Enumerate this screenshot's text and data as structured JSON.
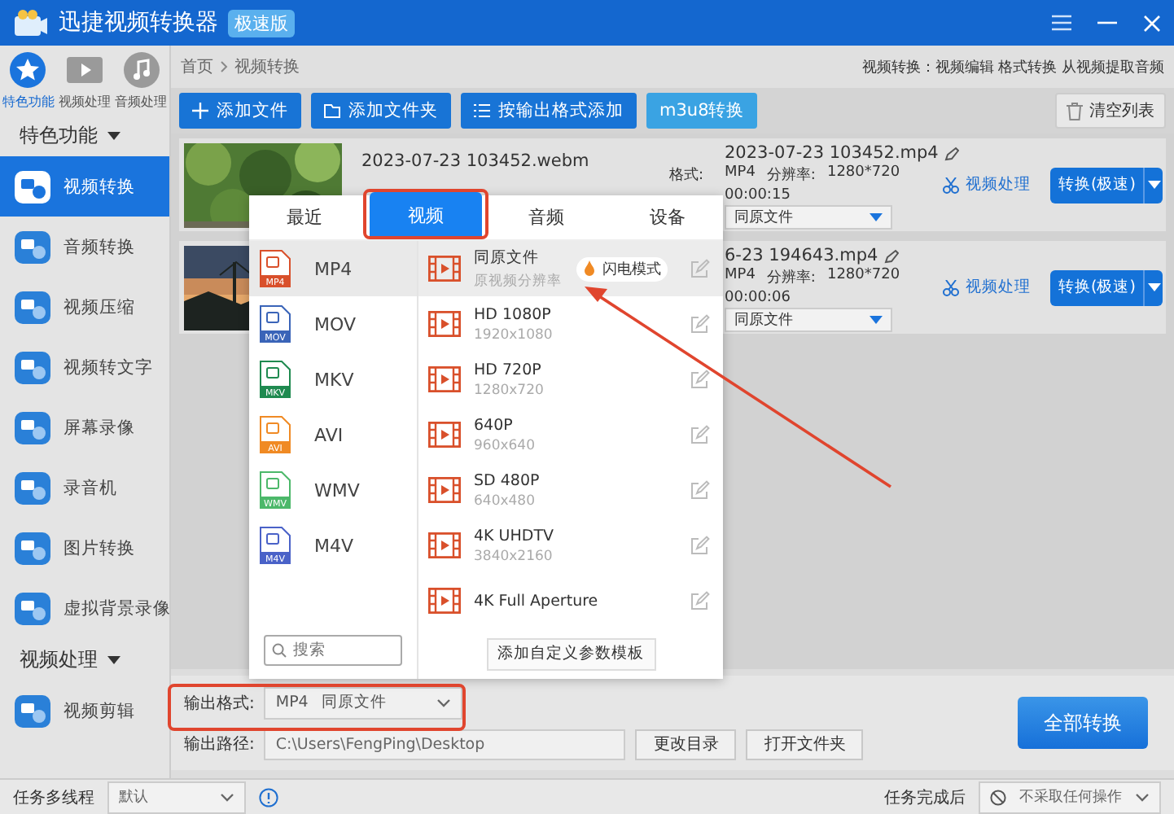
{
  "window": {
    "title": "迅捷视频转换器",
    "badge": "极速版"
  },
  "sidebar": {
    "tabs": [
      {
        "label": "特色功能",
        "kind": "star",
        "selected": true
      },
      {
        "label": "视频处理",
        "kind": "film",
        "selected": false
      },
      {
        "label": "音频处理",
        "kind": "music",
        "selected": false
      }
    ],
    "sections": [
      {
        "title": "特色功能",
        "expanded": true,
        "items": [
          {
            "label": "视频转换",
            "selected": true
          },
          {
            "label": "音频转换",
            "selected": false
          },
          {
            "label": "视频压缩",
            "selected": false
          },
          {
            "label": "视频转文字",
            "selected": false
          },
          {
            "label": "屏幕录像",
            "selected": false
          },
          {
            "label": "录音机",
            "selected": false
          },
          {
            "label": "图片转换",
            "selected": false
          },
          {
            "label": "虚拟背景录像",
            "selected": false
          }
        ]
      },
      {
        "title": "视频处理",
        "expanded": true,
        "items": [
          {
            "label": "视频剪辑",
            "selected": false
          }
        ]
      }
    ]
  },
  "breadcrumb": [
    "首页",
    "视频转换"
  ],
  "hint": "视频转换：视频编辑 格式转换 从视频提取音频",
  "toolbar": {
    "buttons": [
      {
        "label": "添加文件",
        "kind": "plus"
      },
      {
        "label": "添加文件夹",
        "kind": "folder"
      },
      {
        "label": "按输出格式添加",
        "kind": "list"
      },
      {
        "label": "m3u8转换",
        "kind": "plain"
      }
    ],
    "clear": "清空列表"
  },
  "files": [
    {
      "source": "2023-07-23 103452.webm",
      "output": "2023-07-23 103452.mp4",
      "format_label": "格式:",
      "format": "MP4",
      "resolution_label": "分辨率:",
      "resolution": "1280*720",
      "duration": "00:00:15",
      "preset": "同原文件",
      "edit": "视频处理",
      "convert": "转换(极速)"
    },
    {
      "output": "6-23 194643.mp4",
      "format": "MP4",
      "resolution_label": "分辨率:",
      "resolution": "1280*720",
      "duration": "00:00:06",
      "preset": "同原文件",
      "edit": "视频处理",
      "convert": "转换(极速)"
    }
  ],
  "popup": {
    "tabs": [
      {
        "label": "最近",
        "selected": false
      },
      {
        "label": "视频",
        "selected": true
      },
      {
        "label": "音频",
        "selected": false
      },
      {
        "label": "设备",
        "selected": false
      }
    ],
    "formats": [
      {
        "label": "MP4",
        "icon_label": "MP4",
        "color": "#d9502b",
        "selected": true
      },
      {
        "label": "MOV",
        "icon_label": "MOV",
        "color": "#3a64b8",
        "selected": false
      },
      {
        "label": "MKV",
        "icon_label": "MKV",
        "color": "#1f8a50",
        "selected": false
      },
      {
        "label": "AVI",
        "icon_label": "AVI",
        "color": "#f08a24",
        "selected": false
      },
      {
        "label": "WMV",
        "icon_label": "WMV",
        "color": "#4cb86a",
        "selected": false
      },
      {
        "label": "M4V",
        "icon_label": "M4V",
        "color": "#4a62c8",
        "selected": false
      }
    ],
    "search": {
      "placeholder": "搜索"
    },
    "presets": [
      {
        "name": "同原文件",
        "detail": "原视频分辨率",
        "badge": "闪电模式",
        "selected": true
      },
      {
        "name": "HD 1080P",
        "detail": "1920x1080",
        "selected": false
      },
      {
        "name": "HD 720P",
        "detail": "1280x720",
        "selected": false
      },
      {
        "name": "640P",
        "detail": "960x640",
        "selected": false
      },
      {
        "name": "SD 480P",
        "detail": "640x480",
        "selected": false
      },
      {
        "name": "4K UHDTV",
        "detail": "3840x2160",
        "selected": false
      },
      {
        "name": "4K Full Aperture",
        "selected": false
      }
    ],
    "add_template": "添加自定义参数模板"
  },
  "output": {
    "format_label": "输出格式:",
    "format": "MP4",
    "preset": "同原文件",
    "path_label": "输出路径:",
    "path": "C:\\Users\\FengPing\\Desktop",
    "change_dir": "更改目录",
    "open_folder": "打开文件夹",
    "convert_all": "全部转换"
  },
  "status_bar": {
    "threads_label": "任务多线程",
    "threads_value": "默认",
    "after_label": "任务完成后",
    "after_value": "不采取任何操作"
  }
}
